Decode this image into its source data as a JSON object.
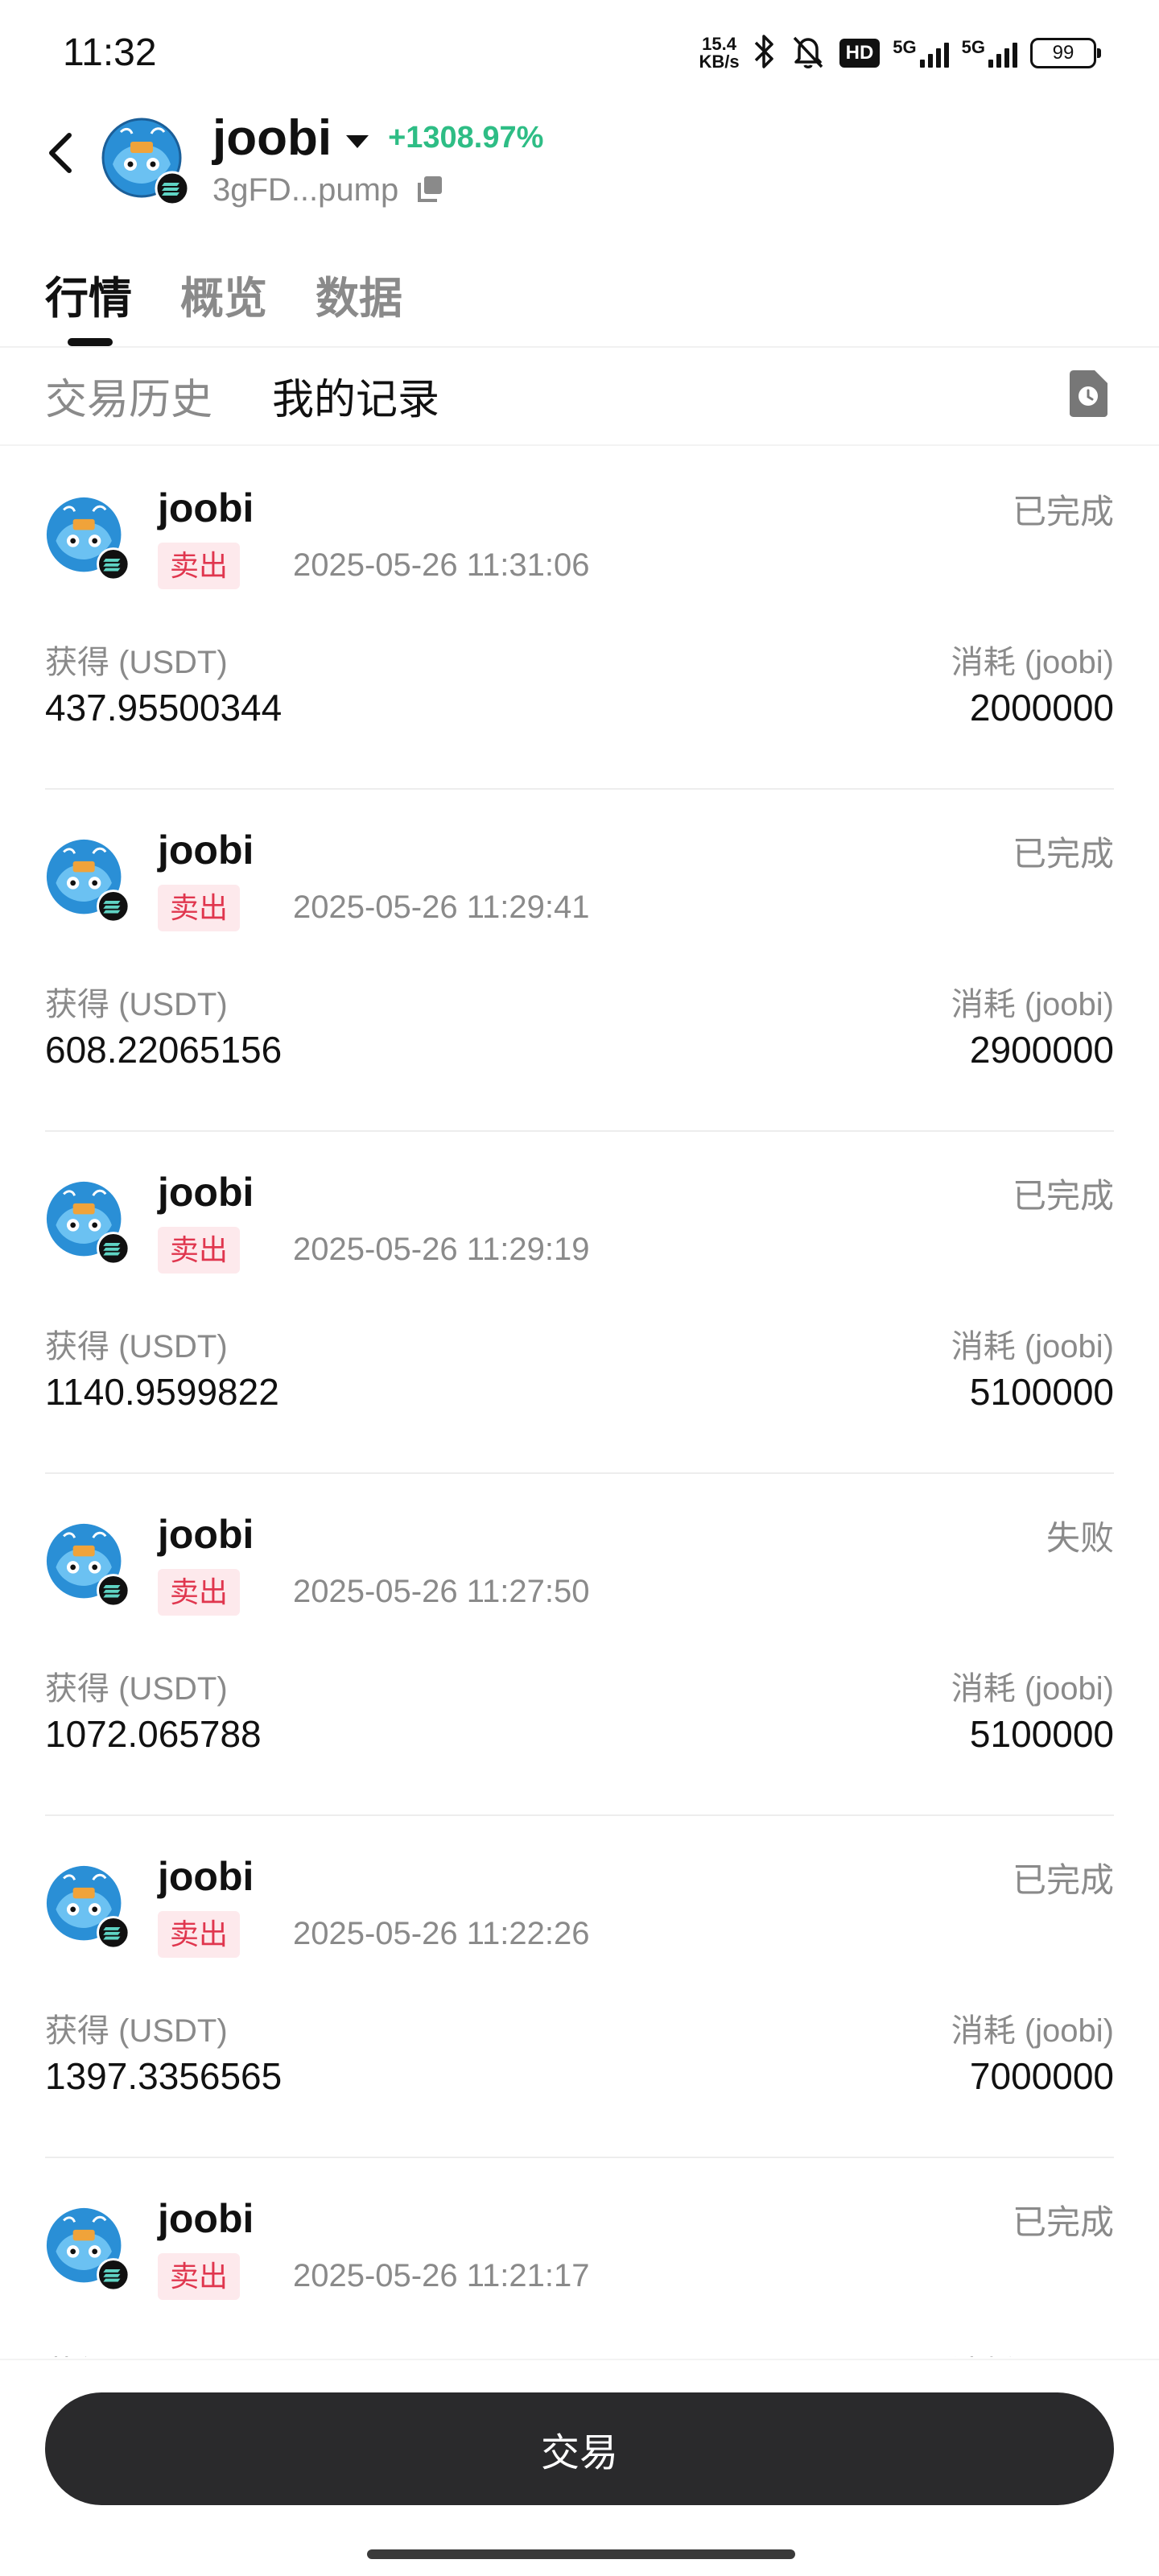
{
  "status_bar": {
    "time": "11:32",
    "net_speed_value": "15.4",
    "net_speed_unit": "KB/s",
    "hd_label": "HD",
    "network_1": "5G",
    "network_2": "5G",
    "battery": "99"
  },
  "header": {
    "token_name": "joobi",
    "change": "+1308.97%",
    "address": "3gFD...pump",
    "change_color": "#2ebd85"
  },
  "main_tabs": [
    {
      "label": "行情",
      "active": true
    },
    {
      "label": "概览",
      "active": false
    },
    {
      "label": "数据",
      "active": false
    }
  ],
  "sub_tabs": [
    {
      "label": "交易历史",
      "active": false
    },
    {
      "label": "我的记录",
      "active": true
    }
  ],
  "records": [
    {
      "name": "joobi",
      "status": "已完成",
      "side": "卖出",
      "time": "2025-05-26 11:31:06",
      "receive_label": "获得 (USDT)",
      "receive_value": "437.95500344",
      "spend_label": "消耗 (joobi)",
      "spend_value": "2000000"
    },
    {
      "name": "joobi",
      "status": "已完成",
      "side": "卖出",
      "time": "2025-05-26 11:29:41",
      "receive_label": "获得 (USDT)",
      "receive_value": "608.22065156",
      "spend_label": "消耗 (joobi)",
      "spend_value": "2900000"
    },
    {
      "name": "joobi",
      "status": "已完成",
      "side": "卖出",
      "time": "2025-05-26 11:29:19",
      "receive_label": "获得 (USDT)",
      "receive_value": "1140.9599822",
      "spend_label": "消耗 (joobi)",
      "spend_value": "5100000"
    },
    {
      "name": "joobi",
      "status": "失败",
      "side": "卖出",
      "time": "2025-05-26 11:27:50",
      "receive_label": "获得 (USDT)",
      "receive_value": "1072.065788",
      "spend_label": "消耗 (joobi)",
      "spend_value": "5100000"
    },
    {
      "name": "joobi",
      "status": "已完成",
      "side": "卖出",
      "time": "2025-05-26 11:22:26",
      "receive_label": "获得 (USDT)",
      "receive_value": "1397.3356565",
      "spend_label": "消耗 (joobi)",
      "spend_value": "7000000"
    },
    {
      "name": "joobi",
      "status": "已完成",
      "side": "卖出",
      "time": "2025-05-26 11:21:17",
      "receive_label": "获得 (USDT)",
      "receive_value": "",
      "spend_label": "消耗 (joobi)",
      "spend_value": ""
    }
  ],
  "trade_button": {
    "label": "交易"
  },
  "icons": {
    "back": "chevron-left-icon",
    "caret": "caret-down-icon",
    "copy": "copy-icon",
    "records_doc": "document-icon",
    "chain": "solana-icon"
  },
  "colors": {
    "sell_badge_bg": "#fde9ec",
    "sell_badge_text": "#e0364e",
    "trade_button_bg": "#2a2a2c",
    "muted_text": "#8a8a8a"
  }
}
